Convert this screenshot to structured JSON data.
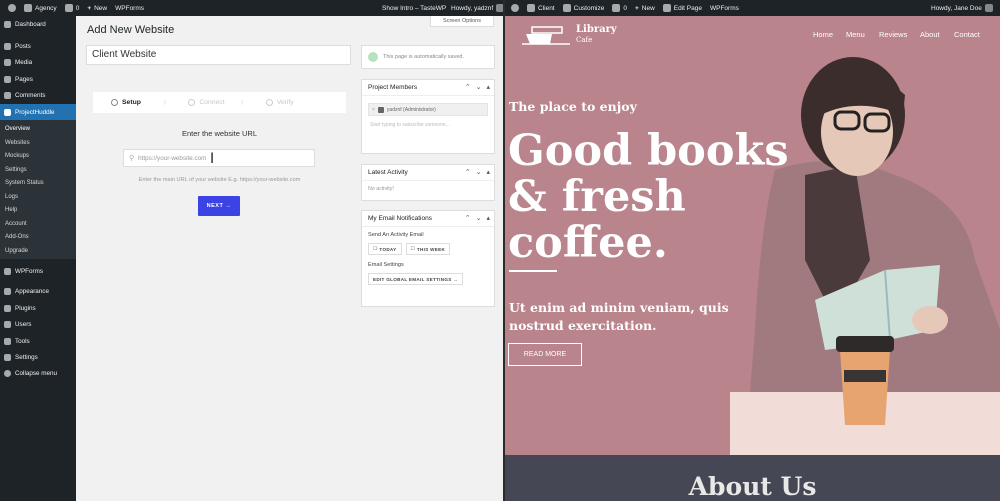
{
  "left_admin_bar": {
    "site": "Agency",
    "comments": "0",
    "new": "New",
    "wpforms": "WPForms",
    "show_intro": "Show Intro – TasteWP",
    "howdy": "Howdy, yadznf"
  },
  "sidebar": {
    "items": [
      {
        "label": "Dashboard",
        "icon": "dashboard-icon"
      },
      {
        "label": "Posts",
        "icon": "pin-icon"
      },
      {
        "label": "Media",
        "icon": "media-icon"
      },
      {
        "label": "Pages",
        "icon": "page-icon"
      },
      {
        "label": "Comments",
        "icon": "comment-icon"
      },
      {
        "label": "ProjectHuddle",
        "icon": "projecthuddle-icon"
      }
    ],
    "submenu": [
      "Overview",
      "Websites",
      "Mockups",
      "Settings",
      "System Status",
      "Logs",
      "Help",
      "Account",
      "Add-Ons",
      "Upgrade"
    ],
    "items2": [
      {
        "label": "WPForms",
        "icon": "wpforms-icon"
      },
      {
        "label": "Appearance",
        "icon": "brush-icon"
      },
      {
        "label": "Plugins",
        "icon": "plugin-icon"
      },
      {
        "label": "Users",
        "icon": "user-icon"
      },
      {
        "label": "Tools",
        "icon": "wrench-icon"
      },
      {
        "label": "Settings",
        "icon": "settings-icon"
      },
      {
        "label": "Collapse menu",
        "icon": "collapse-icon"
      }
    ]
  },
  "main": {
    "title": "Add New Website",
    "screen_options": "Screen Options",
    "title_value": "Client Website",
    "steps": [
      "Setup",
      "Connect",
      "Verify"
    ],
    "enter_label": "Enter the website URL",
    "url_placeholder": "https://your-website.com",
    "help": "Enter the main URL of your website E.g. https://your-website.com",
    "next": "NEXT →"
  },
  "panels": {
    "saved": "This page is automatically saved.",
    "members_title": "Project Members",
    "member": "yadznf (Administrator)",
    "members_hint": "Start typing to subscribe someone...",
    "activity_title": "Latest Activity",
    "activity_empty": "No activity!",
    "email_title": "My Email Notifications",
    "send_label": "Send An Activity Email",
    "today": "TODAY",
    "this_week": "THIS WEEK",
    "email_settings": "Email Settings",
    "edit_global": "EDIT GLOBAL EMAIL SETTINGS →"
  },
  "right_admin_bar": {
    "client": "Client",
    "customize": "Customize",
    "comments": "0",
    "new": "New",
    "edit_page": "Edit Page",
    "wpforms": "WPForms",
    "howdy": "Howdy, Jane Doe"
  },
  "site": {
    "logo_line1": "Library",
    "logo_line2": "Cafe",
    "nav": [
      "Home",
      "Menu",
      "Reviews",
      "About",
      "Contact"
    ],
    "kicker": "The place to enjoy",
    "title_lines": [
      "Good books",
      "& fresh",
      "coffee."
    ],
    "sub_lines": [
      "Ut enim ad minim veniam, quis",
      "nostrud exercitation."
    ],
    "cta": "READ MORE",
    "about": "About Us",
    "accent": "#b9848c"
  }
}
